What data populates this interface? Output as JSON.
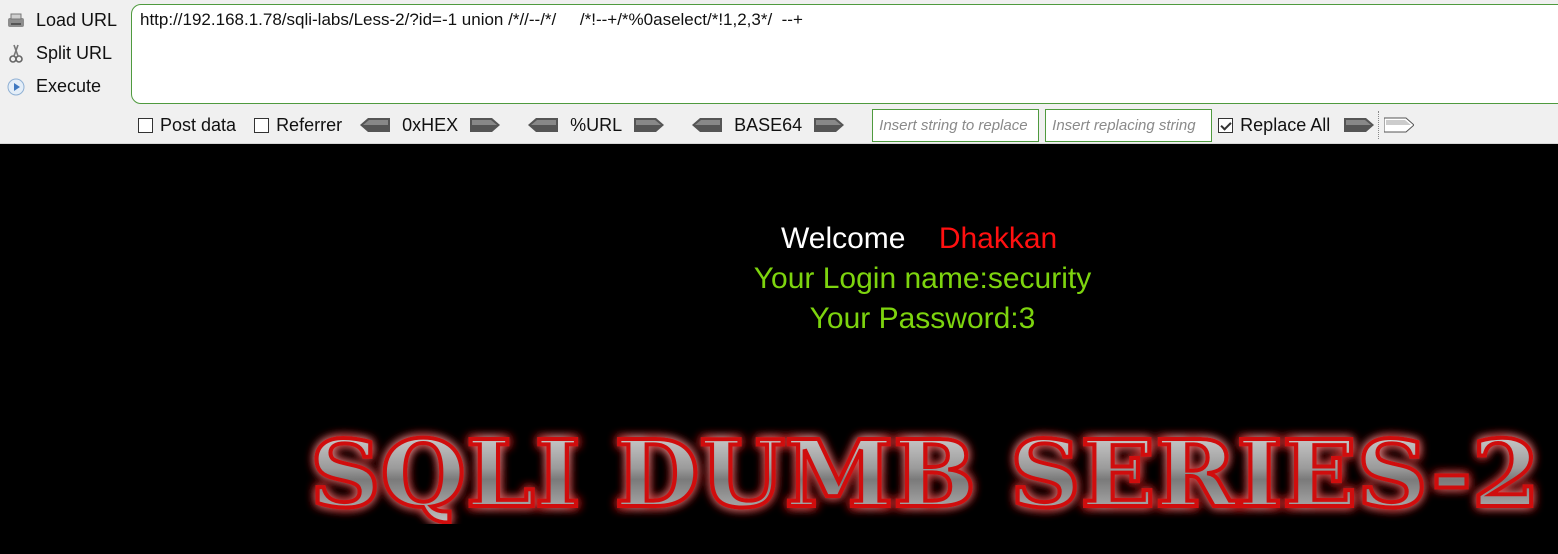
{
  "side_menu": {
    "load_url": "Load URL",
    "split_url": "Split URL",
    "execute": "Execute"
  },
  "url_bar": {
    "value": "http://192.168.1.78/sqli-labs/Less-2/?id=-1 union /*//--/*/     /*!--+/*%0aselect/*!1,2,3*/  --+"
  },
  "options": {
    "post_data": "Post data",
    "referrer": "Referrer",
    "hex": "0xHEX",
    "url_enc": "%URL",
    "base64": "BASE64",
    "insert_placeholder": "Insert string to replace",
    "replace_placeholder": "Insert replacing string",
    "replace_all": "Replace All",
    "replace_all_checked": true
  },
  "page": {
    "welcome": "Welcome",
    "welcome_name": "Dhakkan",
    "login_line": "Your Login name:security",
    "password_line": "Your Password:3",
    "banner_text": "SQLI DUMB SERIES-2"
  },
  "colors": {
    "accent_border": "#4f9a3e",
    "name_red": "#ff1010",
    "result_green": "#7dd40e"
  }
}
